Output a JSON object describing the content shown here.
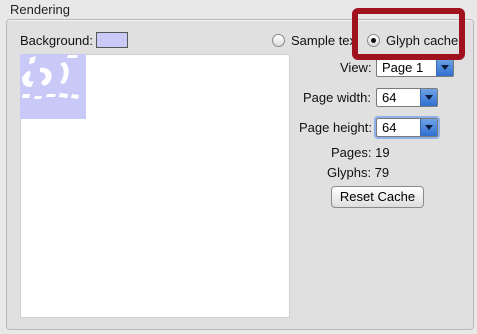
{
  "section_title": "Rendering",
  "background_label": "Background:",
  "background_color": "#c9c9f8",
  "mode_options": [
    "Sample text",
    "Glyph cache"
  ],
  "selected_mode": "Glyph cache",
  "fields": {
    "view": {
      "label": "View:",
      "value": "Page 1"
    },
    "page_width": {
      "label": "Page width:",
      "value": "64"
    },
    "page_height": {
      "label": "Page height:",
      "value": "64"
    }
  },
  "stats": {
    "pages": "Pages: 19",
    "glyphs": "Glyphs: 79"
  },
  "reset_button": "Reset Cache",
  "highlight_color": "#a1121f"
}
